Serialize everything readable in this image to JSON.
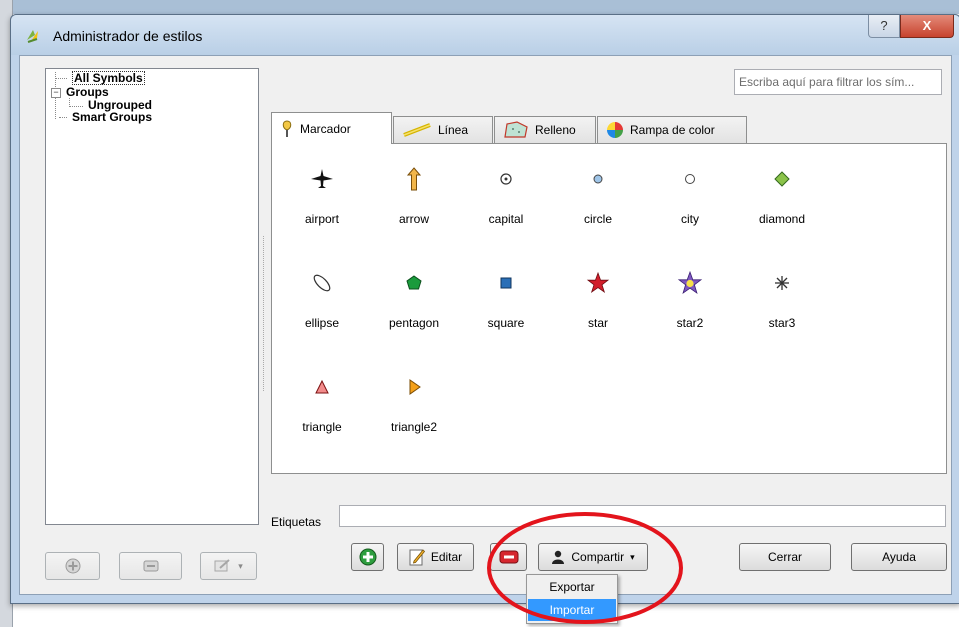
{
  "window": {
    "title": "Administrador de estilos",
    "help_glyph": "?",
    "close_glyph": "X"
  },
  "tree": {
    "items": [
      {
        "label": "All Symbols"
      },
      {
        "label": "Groups"
      },
      {
        "label": "Ungrouped"
      },
      {
        "label": "Smart Groups"
      }
    ]
  },
  "filter": {
    "placeholder": "Escriba aquí para filtrar los sím..."
  },
  "tabs": [
    {
      "label": "Marcador",
      "icon": "marker-icon"
    },
    {
      "label": "Línea",
      "icon": "line-icon"
    },
    {
      "label": "Relleno",
      "icon": "fill-icon"
    },
    {
      "label": "Rampa de color",
      "icon": "color-ramp-icon"
    }
  ],
  "symbols": [
    {
      "label": "airport",
      "icon": "airport-icon"
    },
    {
      "label": "arrow",
      "icon": "arrow-icon"
    },
    {
      "label": "capital",
      "icon": "capital-icon"
    },
    {
      "label": "circle",
      "icon": "circle-icon"
    },
    {
      "label": "city",
      "icon": "city-icon"
    },
    {
      "label": "diamond",
      "icon": "diamond-icon"
    },
    {
      "label": "ellipse",
      "icon": "ellipse-icon"
    },
    {
      "label": "pentagon",
      "icon": "pentagon-icon"
    },
    {
      "label": "square",
      "icon": "square-icon"
    },
    {
      "label": "star",
      "icon": "star-icon"
    },
    {
      "label": "star2",
      "icon": "star2-icon"
    },
    {
      "label": "star3",
      "icon": "star3-icon"
    },
    {
      "label": "triangle",
      "icon": "triangle-icon"
    },
    {
      "label": "triangle2",
      "icon": "triangle2-icon"
    }
  ],
  "tags": {
    "label": "Etiquetas",
    "value": ""
  },
  "buttons": {
    "edit": "Editar",
    "share": "Compartir",
    "close": "Cerrar",
    "help": "Ayuda"
  },
  "share_menu": {
    "items": [
      {
        "label": "Exportar",
        "selected": false
      },
      {
        "label": "Importar",
        "selected": true
      }
    ]
  },
  "colors": {
    "annotation": "#e3141c",
    "menu_highlight": "#3399ff"
  }
}
